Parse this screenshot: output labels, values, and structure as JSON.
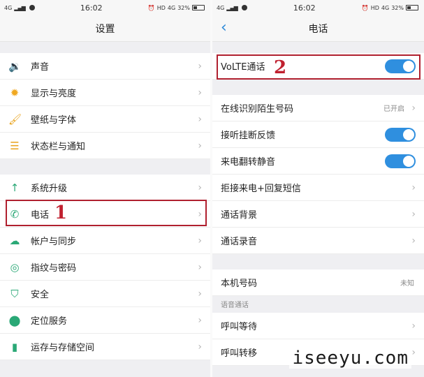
{
  "status_bar": {
    "network": "4G",
    "time": "16:02",
    "hd": "HD",
    "net2": "4G",
    "battery": "32%"
  },
  "left_screen": {
    "title": "设置",
    "items": [
      {
        "label": "声音",
        "icon": "speaker-icon"
      },
      {
        "label": "显示与亮度",
        "icon": "sun-icon"
      },
      {
        "label": "壁纸与字体",
        "icon": "brush-icon"
      },
      {
        "label": "状态栏与通知",
        "icon": "menu-icon"
      },
      {
        "label": "系统升级",
        "icon": "arrow-up-icon"
      },
      {
        "label": "电话",
        "icon": "phone-icon"
      },
      {
        "label": "帐户与同步",
        "icon": "cloud-icon"
      },
      {
        "label": "指纹与密码",
        "icon": "fingerprint-icon"
      },
      {
        "label": "安全",
        "icon": "shield-icon"
      },
      {
        "label": "定位服务",
        "icon": "location-pin-icon"
      },
      {
        "label": "运存与存储空间",
        "icon": "storage-icon"
      }
    ]
  },
  "right_screen": {
    "title": "电话",
    "volte": {
      "label": "VoLTE通话",
      "on": true
    },
    "items": [
      {
        "label": "在线识别陌生号码",
        "value": "已开启"
      },
      {
        "label": "接听挂断反馈",
        "on": true
      },
      {
        "label": "来电翻转静音",
        "on": true
      },
      {
        "label": "拒接来电+回复短信"
      },
      {
        "label": "通话背景"
      },
      {
        "label": "通话录音"
      }
    ],
    "number": {
      "label": "本机号码",
      "value": "未知"
    },
    "section_voice": "语音通话",
    "voice_items": [
      {
        "label": "呼叫等待"
      },
      {
        "label": "呼叫转移"
      }
    ]
  },
  "annotations": {
    "step1": "1",
    "step2": "2"
  },
  "watermark": "iseeyu.com",
  "colors": {
    "accent": "#2f8fdf",
    "annotation": "#b0202f"
  }
}
